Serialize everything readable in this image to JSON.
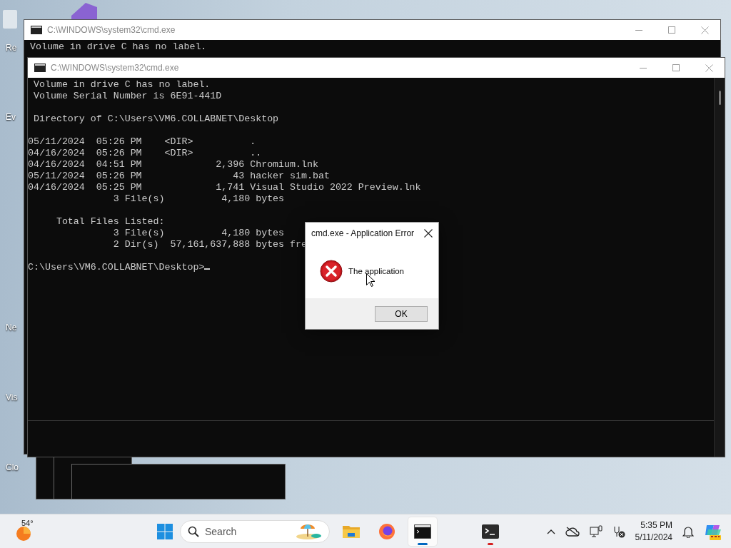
{
  "desktop_icons": [
    {
      "label": "Re"
    },
    {
      "label": "Ev"
    },
    {
      "label": "Ne"
    },
    {
      "label": "Vis"
    },
    {
      "label": "Clo"
    }
  ],
  "back_window": {
    "title": "C:\\WINDOWS\\system32\\cmd.exe",
    "lines": [
      " Volume in drive C has no label."
    ]
  },
  "front_window": {
    "title": "C:\\WINDOWS\\system32\\cmd.exe",
    "output_blocks": [
      [
        " Volume in drive C has no label.",
        " Volume Serial Number is 6E91-441D"
      ],
      [
        " Directory of C:\\Users\\VM6.COLLABNET\\Desktop"
      ],
      [
        "05/11/2024  05:26 PM    <DIR>          .",
        "04/16/2024  05:26 PM    <DIR>          ..",
        "04/16/2024  04:51 PM             2,396 Chromium.lnk",
        "05/11/2024  05:26 PM                43 hacker sim.bat",
        "04/16/2024  05:25 PM             1,741 Visual Studio 2022 Preview.lnk",
        "               3 File(s)          4,180 bytes"
      ],
      [
        "     Total Files Listed:",
        "               3 File(s)          4,180 bytes",
        "               2 Dir(s)  57,161,637,888 bytes fre"
      ]
    ],
    "prompt": "C:\\Users\\VM6.COLLABNET\\Desktop>"
  },
  "error_dialog": {
    "title": "cmd.exe - Application Error",
    "message": "The application",
    "button": "OK"
  },
  "taskbar": {
    "weather": "54°",
    "search_placeholder": "Search",
    "apps": [
      {
        "kind": "files",
        "selected": false,
        "attention": false
      },
      {
        "kind": "firefox",
        "selected": false,
        "attention": false
      },
      {
        "kind": "cmd",
        "selected": true,
        "attention": false
      },
      {
        "kind": "terminal",
        "selected": false,
        "attention": true
      }
    ],
    "time": "5:35 PM",
    "date": "5/11/2024"
  }
}
